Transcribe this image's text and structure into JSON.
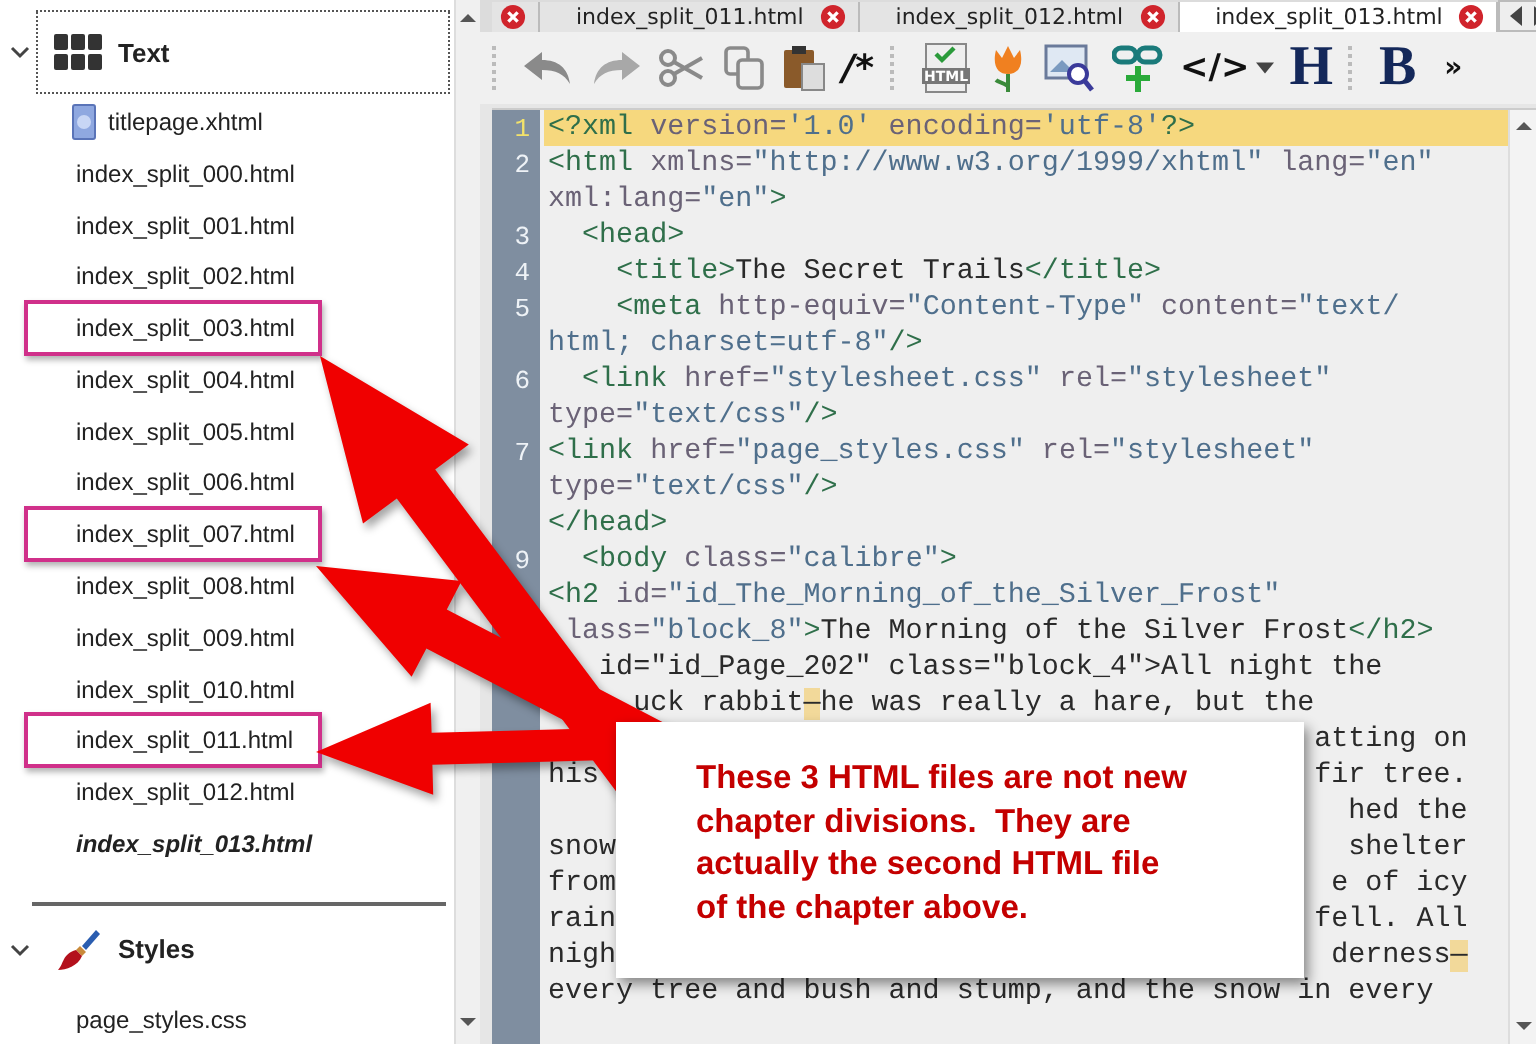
{
  "tree": {
    "groups": [
      {
        "label": "Text",
        "kind": "text",
        "expanded": true,
        "selected": true,
        "items": [
          {
            "label": "titlepage.xhtml",
            "kind": "image",
            "current": false,
            "highlighted": false
          },
          {
            "label": "index_split_000.html",
            "kind": "html",
            "current": false,
            "highlighted": false
          },
          {
            "label": "index_split_001.html",
            "kind": "html",
            "current": false,
            "highlighted": false
          },
          {
            "label": "index_split_002.html",
            "kind": "html",
            "current": false,
            "highlighted": false
          },
          {
            "label": "index_split_003.html",
            "kind": "html",
            "current": false,
            "highlighted": true
          },
          {
            "label": "index_split_004.html",
            "kind": "html",
            "current": false,
            "highlighted": false
          },
          {
            "label": "index_split_005.html",
            "kind": "html",
            "current": false,
            "highlighted": false
          },
          {
            "label": "index_split_006.html",
            "kind": "html",
            "current": false,
            "highlighted": false
          },
          {
            "label": "index_split_007.html",
            "kind": "html",
            "current": false,
            "highlighted": true
          },
          {
            "label": "index_split_008.html",
            "kind": "html",
            "current": false,
            "highlighted": false
          },
          {
            "label": "index_split_009.html",
            "kind": "html",
            "current": false,
            "highlighted": false
          },
          {
            "label": "index_split_010.html",
            "kind": "html",
            "current": false,
            "highlighted": false
          },
          {
            "label": "index_split_011.html",
            "kind": "html",
            "current": false,
            "highlighted": true
          },
          {
            "label": "index_split_012.html",
            "kind": "html",
            "current": false,
            "highlighted": false
          },
          {
            "label": "index_split_013.html",
            "kind": "html",
            "current": true,
            "highlighted": false
          }
        ]
      },
      {
        "label": "Styles",
        "kind": "styles",
        "expanded": true,
        "selected": false,
        "items": [
          {
            "label": "page_styles.css",
            "kind": "css",
            "current": false,
            "highlighted": false
          }
        ]
      }
    ]
  },
  "tabs_clipped_left": true,
  "tabs": [
    {
      "label": "index_split_011.html",
      "selected": false
    },
    {
      "label": "index_split_012.html",
      "selected": false
    },
    {
      "label": "index_split_013.html",
      "selected": true
    }
  ],
  "toolbar": [
    {
      "kind": "undo"
    },
    {
      "kind": "redo"
    },
    {
      "kind": "cut"
    },
    {
      "kind": "copy"
    },
    {
      "kind": "paste"
    },
    {
      "kind": "glyph",
      "text": "/*"
    },
    {
      "kind": "html-file",
      "text": "HTML"
    },
    {
      "kind": "tulip"
    },
    {
      "kind": "image-search"
    },
    {
      "kind": "link-add"
    },
    {
      "kind": "glyph-menu",
      "text": "</>"
    },
    {
      "kind": "heading",
      "text": "H"
    },
    {
      "kind": "heading",
      "text": "B"
    },
    {
      "kind": "more",
      "text": "»"
    }
  ],
  "editor": {
    "lines": [
      {
        "number": "1",
        "text": "<?xml version='1.0' encoding='utf-8'?>",
        "current": true
      },
      {
        "number": "2",
        "text": "<html xmlns=\"http://www.w3.org/1999/xhtml\" lang=\"en\"",
        "current": false
      },
      {
        "text": "xml:lang=\"en\">",
        "current": false
      },
      {
        "number": "3",
        "text": "  <head>",
        "current": false
      },
      {
        "number": "4",
        "text": "    <title>The Secret Trails</title>",
        "current": false
      },
      {
        "number": "5",
        "text": "    <meta http-equiv=\"Content-Type\" content=\"text/",
        "current": false
      },
      {
        "text": "html; charset=utf-8\"/>",
        "current": false
      },
      {
        "number": "6",
        "text": "  <link href=\"stylesheet.css\" rel=\"stylesheet\"",
        "current": false
      },
      {
        "text": "type=\"text/css\"/>",
        "current": false
      },
      {
        "number": "7",
        "text": "<link href=\"page_styles.css\" rel=\"stylesheet\"",
        "current": false
      },
      {
        "text": "type=\"text/css\"/>",
        "current": false
      },
      {
        "text": "</head>",
        "current": false
      },
      {
        "number": "9",
        "text": "  <body class=\"calibre\">",
        "current": false
      },
      {
        "text": "<h2 id=\"id_The_Morning_of_the_Silver_Frost\"",
        "current": false
      },
      {
        "text": " lass=\"block_8\">The Morning of the Silver Frost</h2>",
        "current": false
      },
      {
        "text": "   id=\"id_Page_202\" class=\"block_4\">All night the",
        "current": false
      },
      {
        "text": "     uck rabbit—he was really a hare, but the",
        "current": false
      },
      {
        "right": "atting on",
        "current": false
      },
      {
        "text": "his",
        "right": "fir tree.",
        "current": false
      },
      {
        "right": "hed the",
        "current": false
      },
      {
        "text": "snow",
        "right": "shelter",
        "current": false
      },
      {
        "text": "from",
        "right": "e of icy",
        "current": false
      },
      {
        "text": "rain",
        "right": "fell. All",
        "current": false
      },
      {
        "text": "nigh",
        "right": "derness—",
        "current": false
      },
      {
        "text": "every tree and bush and stump, and the snow in every",
        "current": false
      }
    ]
  },
  "callout": {
    "lines": [
      "These 3 HTML files are not new",
      "chapter divisions.  They are",
      "actually the second HTML file",
      "of the chapter above."
    ]
  }
}
